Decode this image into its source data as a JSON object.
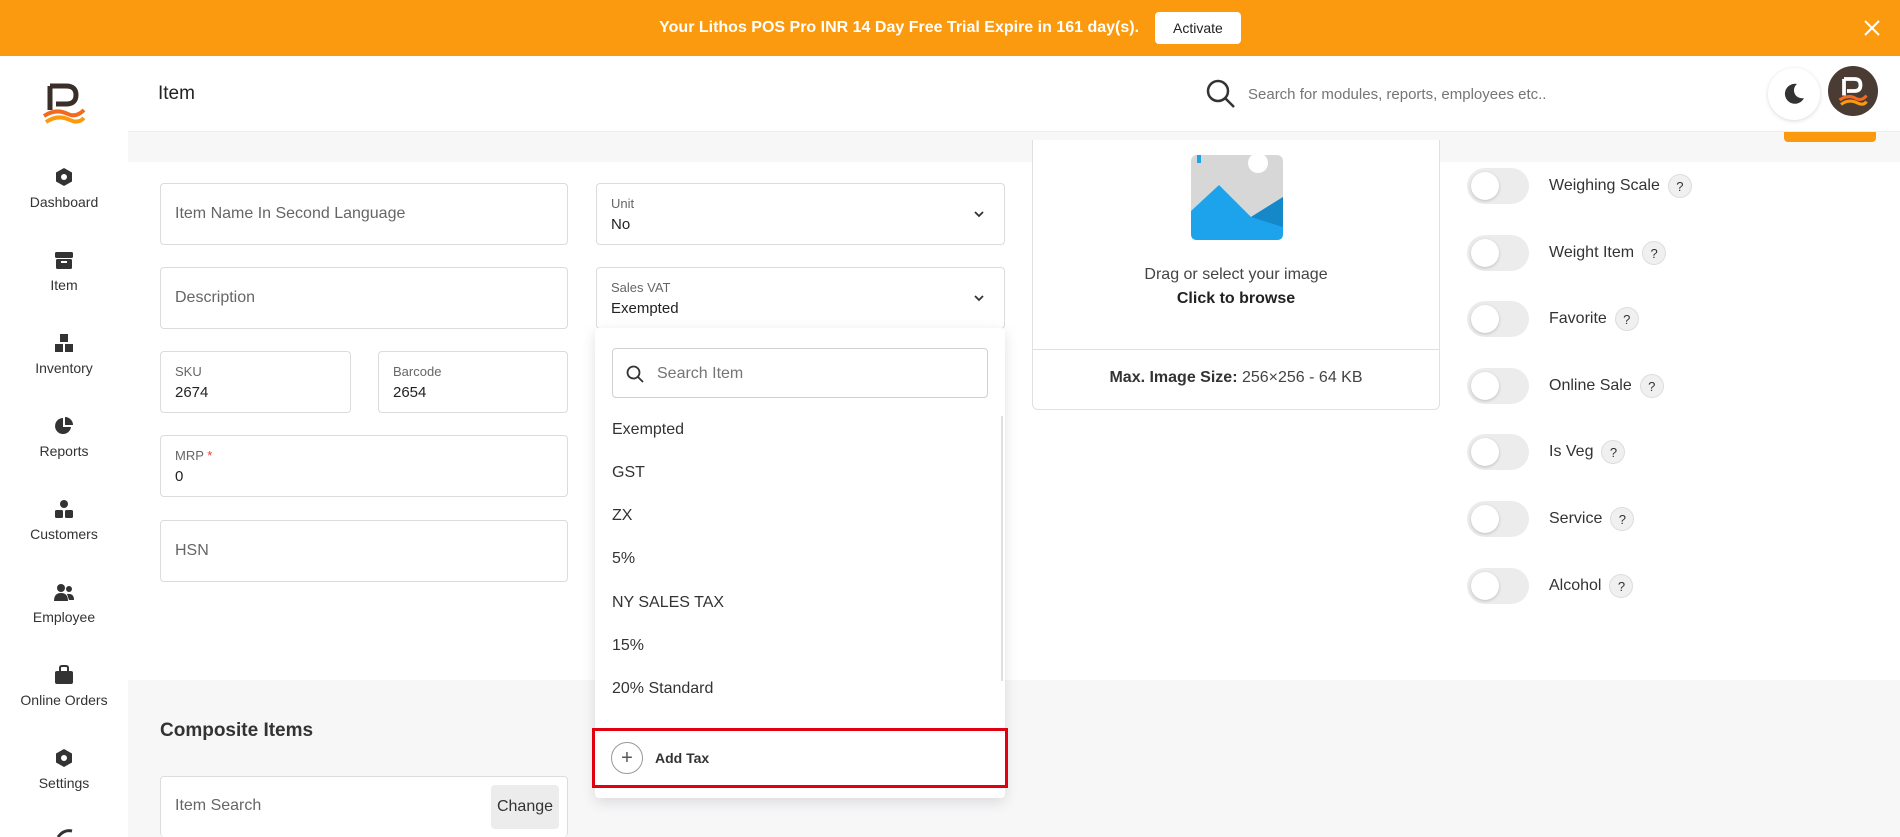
{
  "banner": {
    "text": "Your Lithos POS Pro INR 14 Day Free Trial Expire in 161 day(s).",
    "activate_label": "Activate"
  },
  "colors": {
    "accent": "#fb9a0e",
    "highlight_border": "#e00010"
  },
  "sidebar": {
    "items": [
      {
        "label": "Dashboard",
        "icon": "dashboard-icon"
      },
      {
        "label": "Item",
        "icon": "item-icon"
      },
      {
        "label": "Inventory",
        "icon": "inventory-icon"
      },
      {
        "label": "Reports",
        "icon": "reports-icon"
      },
      {
        "label": "Customers",
        "icon": "customers-icon"
      },
      {
        "label": "Employee",
        "icon": "employee-icon"
      },
      {
        "label": "Online Orders",
        "icon": "online-orders-icon"
      },
      {
        "label": "Settings",
        "icon": "settings-icon"
      }
    ]
  },
  "header": {
    "title": "Item",
    "search_placeholder": "Search for modules, reports, employees etc.."
  },
  "form": {
    "second_language_placeholder": "Item Name In Second Language",
    "description_placeholder": "Description",
    "sku": {
      "label": "SKU",
      "value": "2674"
    },
    "barcode": {
      "label": "Barcode",
      "value": "2654"
    },
    "mrp": {
      "label": "MRP",
      "required_mark": "*",
      "value": "0"
    },
    "hsn_placeholder": "HSN",
    "unit": {
      "label": "Unit",
      "value": "No"
    },
    "sales_vat": {
      "label": "Sales VAT",
      "value": "Exempted"
    }
  },
  "dropdown": {
    "search_placeholder": "Search Item",
    "options": [
      "Exempted",
      "GST",
      "ZX",
      "5%",
      "NY SALES TAX",
      "15%",
      "20% Standard"
    ],
    "add_label": "Add Tax"
  },
  "image_upload": {
    "drag_text": "Drag or select your image",
    "browse_text": "Click to browse",
    "max_label": "Max. Image Size:",
    "max_value": "256×256 - 64 KB"
  },
  "toggles": [
    {
      "label": "Weighing Scale",
      "on": false
    },
    {
      "label": "Weight Item",
      "on": false
    },
    {
      "label": "Favorite",
      "on": false
    },
    {
      "label": "Online Sale",
      "on": false
    },
    {
      "label": "Is Veg",
      "on": false
    },
    {
      "label": "Service",
      "on": false
    },
    {
      "label": "Alcohol",
      "on": false
    }
  ],
  "help_glyph": "?",
  "composite": {
    "title": "Composite Items",
    "search_placeholder": "Item Search",
    "change_label": "Change"
  }
}
